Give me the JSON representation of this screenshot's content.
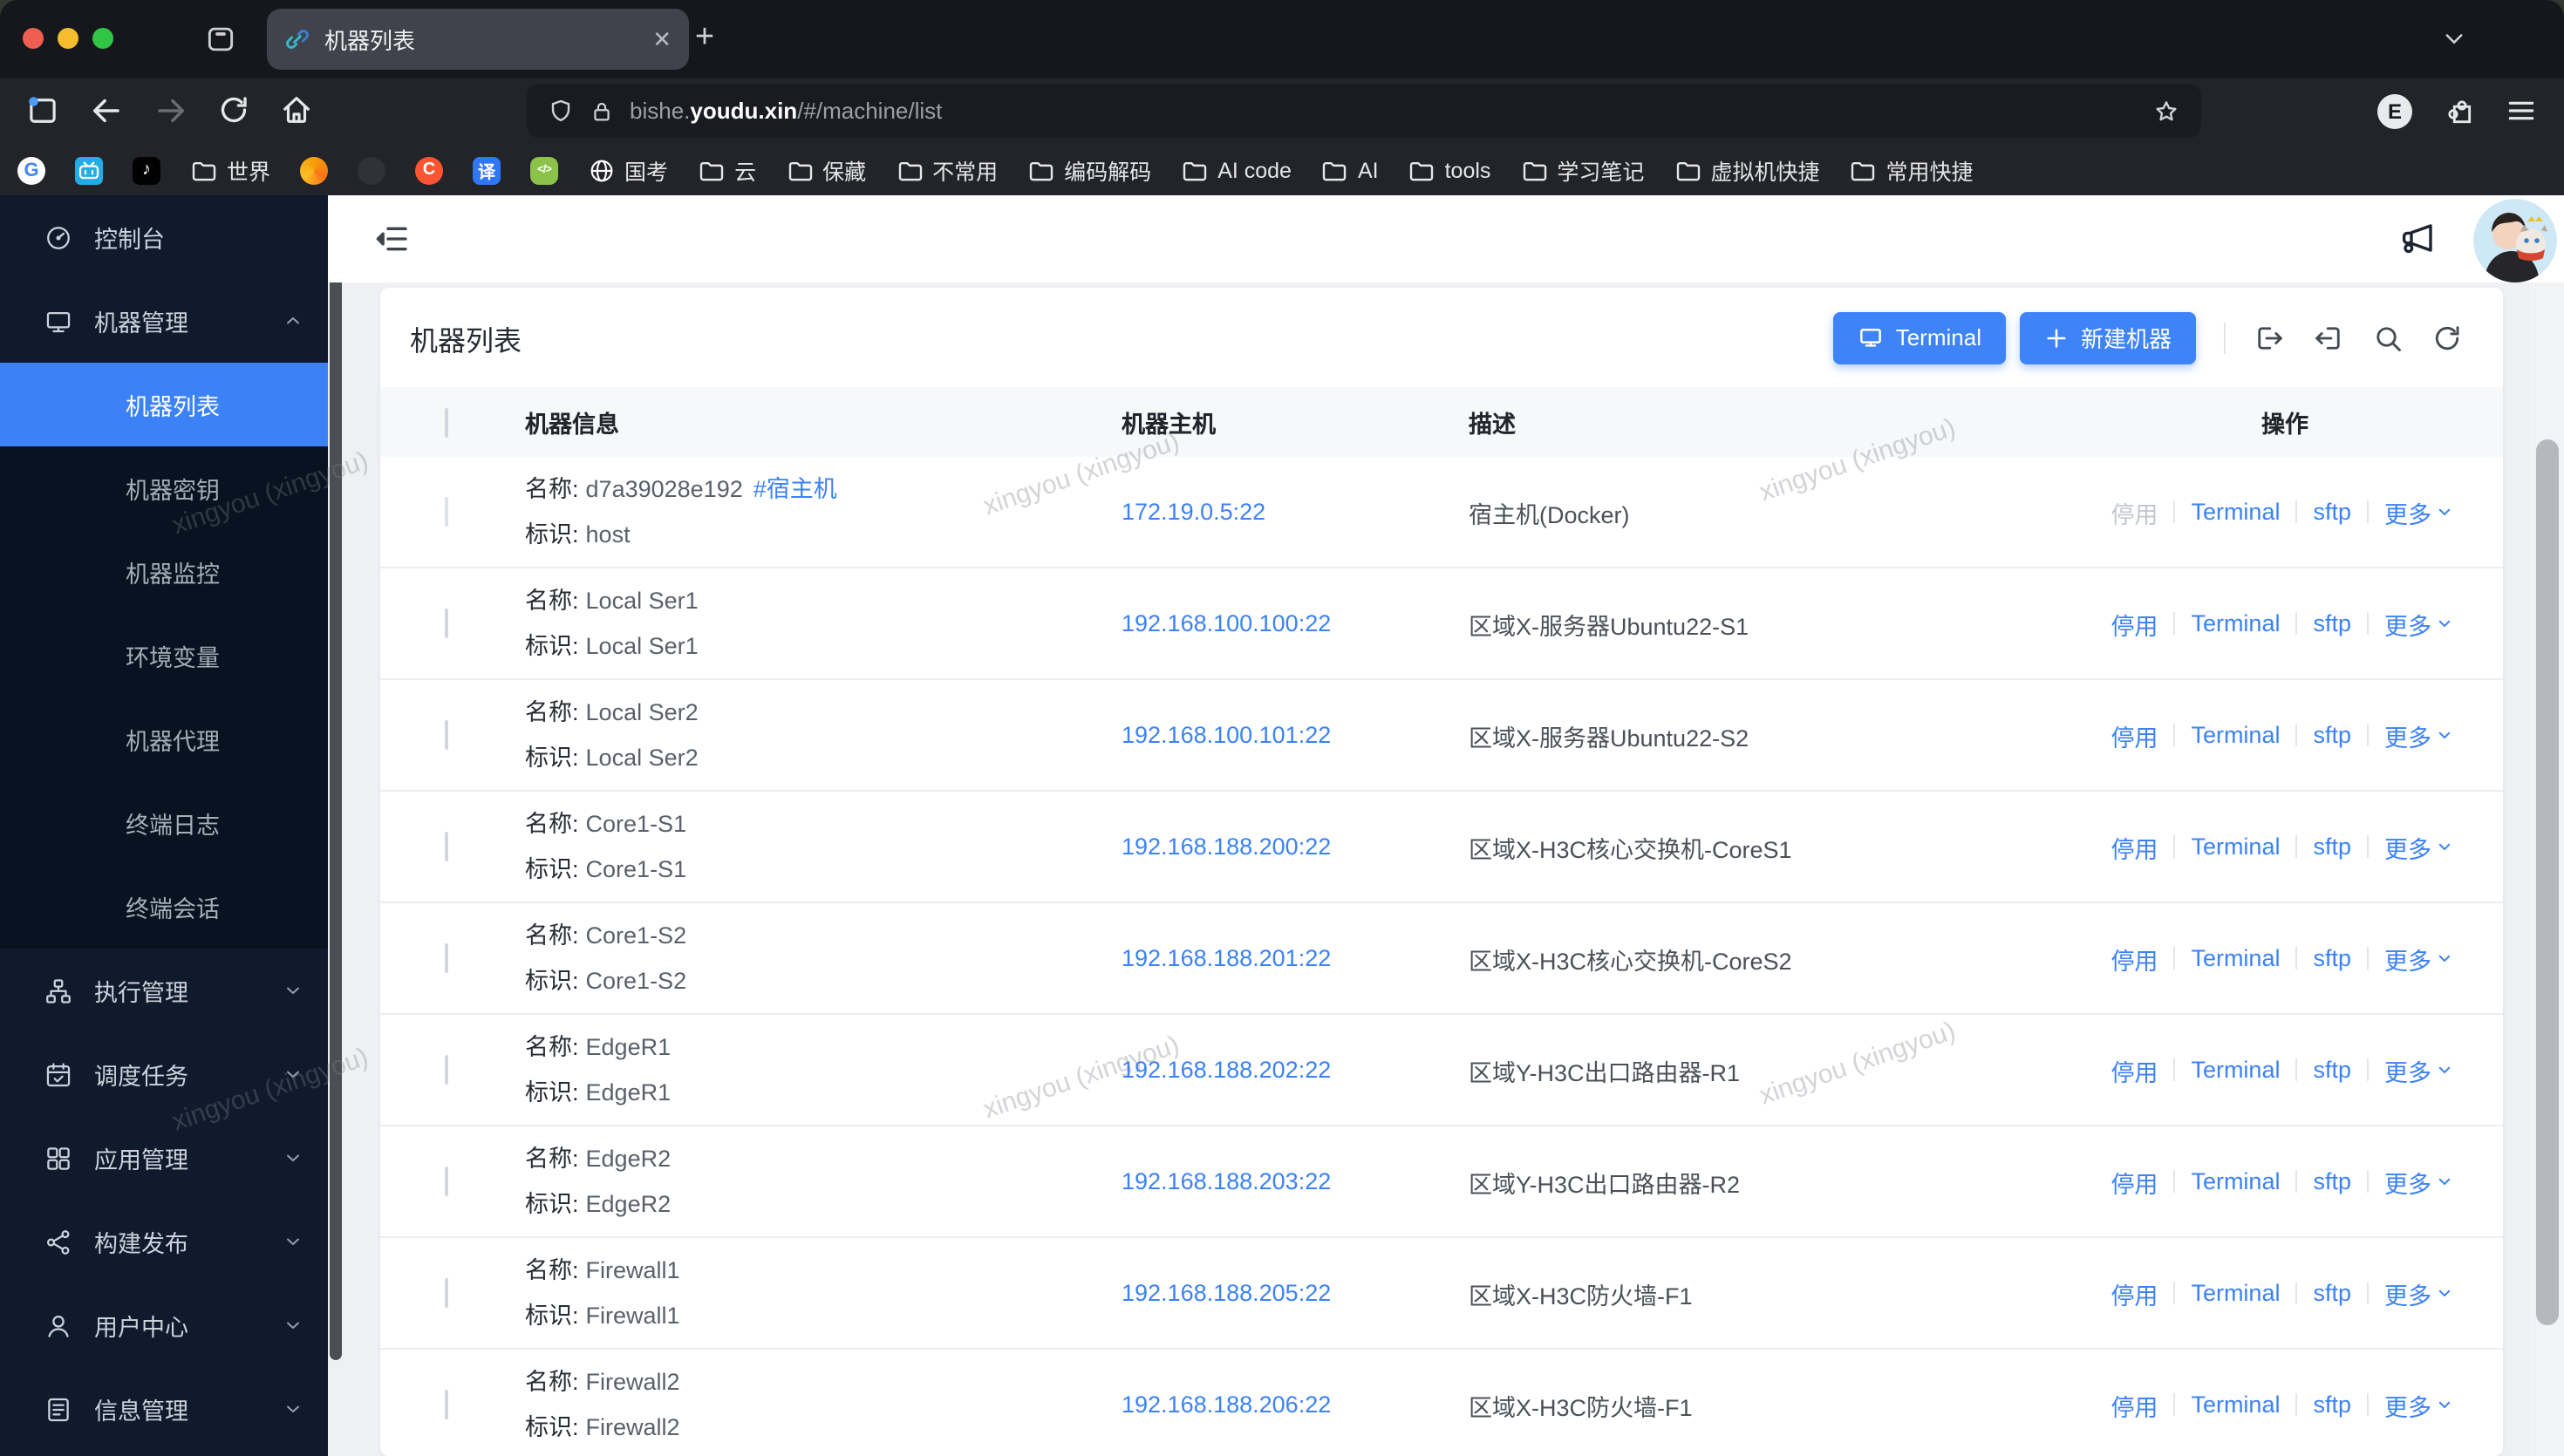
{
  "browser": {
    "tab_title": "机器列表",
    "new_tab": "+",
    "url": {
      "prefix": "bishe.",
      "domain": "youdu.xin",
      "path": "/#/machine/list"
    },
    "extension_badge": "E",
    "bookmarks": [
      {
        "name": "google",
        "type": "google",
        "glyph": "G",
        "label": ""
      },
      {
        "name": "bilibili",
        "type": "bilibili",
        "label": ""
      },
      {
        "name": "tiktok",
        "type": "tiktok",
        "glyph": "♪",
        "label": ""
      },
      {
        "name": "shijie",
        "type": "folder",
        "label": "世界"
      },
      {
        "name": "flame",
        "type": "flame",
        "glyph": "",
        "label": ""
      },
      {
        "name": "github",
        "type": "github",
        "glyph": "",
        "label": ""
      },
      {
        "name": "csdn",
        "type": "csdn",
        "glyph": "C",
        "label": ""
      },
      {
        "name": "translate",
        "type": "translate",
        "glyph": "译",
        "label": ""
      },
      {
        "name": "code",
        "type": "code",
        "glyph": "</>",
        "label": ""
      },
      {
        "name": "guokao",
        "type": "globe",
        "label": "国考"
      },
      {
        "name": "yun",
        "type": "folder",
        "label": "云"
      },
      {
        "name": "baocang",
        "type": "folder",
        "label": "保藏"
      },
      {
        "name": "buchangyong",
        "type": "folder",
        "label": "不常用"
      },
      {
        "name": "bianma",
        "type": "folder",
        "label": "编码解码"
      },
      {
        "name": "aicode",
        "type": "folder",
        "label": "AI code"
      },
      {
        "name": "ai",
        "type": "folder",
        "label": "AI"
      },
      {
        "name": "tools",
        "type": "folder",
        "label": "tools"
      },
      {
        "name": "xuexi",
        "type": "folder",
        "label": "学习笔记"
      },
      {
        "name": "vmkj",
        "type": "folder",
        "label": "虚拟机快捷"
      },
      {
        "name": "cykj",
        "type": "folder",
        "label": "常用快捷"
      }
    ]
  },
  "sidebar": {
    "items": [
      {
        "icon": "dashboard-icon",
        "label": "控制台"
      },
      {
        "icon": "monitor-icon",
        "label": "机器管理",
        "chevron": "up",
        "children": [
          {
            "label": "机器列表",
            "active": true
          },
          {
            "label": "机器密钥"
          },
          {
            "label": "机器监控"
          },
          {
            "label": "环境变量"
          },
          {
            "label": "机器代理"
          },
          {
            "label": "终端日志"
          },
          {
            "label": "终端会话"
          }
        ]
      },
      {
        "icon": "sitemap-icon",
        "label": "执行管理",
        "chevron": "down"
      },
      {
        "icon": "calendar-icon",
        "label": "调度任务",
        "chevron": "down"
      },
      {
        "icon": "apps-icon",
        "label": "应用管理",
        "chevron": "down"
      },
      {
        "icon": "nodes-icon",
        "label": "构建发布",
        "chevron": "down"
      },
      {
        "icon": "user-icon",
        "label": "用户中心",
        "chevron": "down"
      },
      {
        "icon": "doc-icon",
        "label": "信息管理",
        "chevron": "down"
      }
    ]
  },
  "page": {
    "title": "机器列表",
    "toolbar": {
      "terminal_label": "Terminal",
      "create_label": "新建机器"
    },
    "table": {
      "headers": [
        "机器信息",
        "机器主机",
        "描述",
        "操作"
      ],
      "row_labels": {
        "name": "名称:",
        "id": "标识:"
      },
      "actions": {
        "disable": "停用",
        "terminal": "Terminal",
        "sftp": "sftp",
        "more": "更多"
      },
      "rows": [
        {
          "name": "d7a39028e192",
          "tag": "#宿主机",
          "id": "host",
          "host": "172.19.0.5:22",
          "desc": "宿主机(Docker)",
          "disabled": true
        },
        {
          "name": "Local Ser1",
          "id": "Local Ser1",
          "host": "192.168.100.100:22",
          "desc": "区域X-服务器Ubuntu22-S1"
        },
        {
          "name": "Local Ser2",
          "id": "Local Ser2",
          "host": "192.168.100.101:22",
          "desc": "区域X-服务器Ubuntu22-S2"
        },
        {
          "name": "Core1-S1",
          "id": "Core1-S1",
          "host": "192.168.188.200:22",
          "desc": "区域X-H3C核心交换机-CoreS1"
        },
        {
          "name": "Core1-S2",
          "id": "Core1-S2",
          "host": "192.168.188.201:22",
          "desc": "区域X-H3C核心交换机-CoreS2"
        },
        {
          "name": "EdgeR1",
          "id": "EdgeR1",
          "host": "192.168.188.202:22",
          "desc": "区域Y-H3C出口路由器-R1"
        },
        {
          "name": "EdgeR2",
          "id": "EdgeR2",
          "host": "192.168.188.203:22",
          "desc": "区域Y-H3C出口路由器-R2"
        },
        {
          "name": "Firewall1",
          "id": "Firewall1",
          "host": "192.168.188.205:22",
          "desc": "区域X-H3C防火墙-F1"
        },
        {
          "name": "Firewall2",
          "id": "Firewall2",
          "host": "192.168.188.206:22",
          "desc": "区域X-H3C防火墙-F1"
        }
      ]
    }
  },
  "watermark": "xingyou (xingyou)",
  "colors": {
    "accent_blue": "#3E83F7",
    "link_blue": "#3B82F6",
    "sidebar_active": "#3C82F6",
    "disabled_text": "#C2C7CF",
    "bilibili": "#23ADE5",
    "csdn": "#FC5531",
    "translate": "#2E77F6",
    "code_green": "#8BC34A",
    "tiktok": "#010101"
  }
}
